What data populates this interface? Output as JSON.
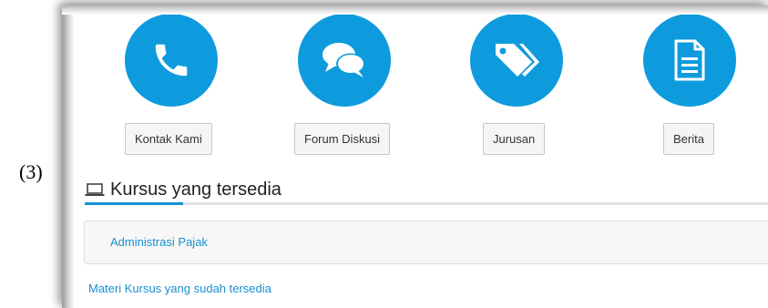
{
  "figure_label": "(3)",
  "quick_links": [
    {
      "label": "Kontak Kami",
      "icon": "phone-icon"
    },
    {
      "label": "Forum Diskusi",
      "icon": "chat-bubbles-icon"
    },
    {
      "label": "Jurusan",
      "icon": "tags-icon"
    },
    {
      "label": "Berita",
      "icon": "document-icon"
    }
  ],
  "section": {
    "title": "Kursus yang tersedia",
    "icon": "laptop-icon"
  },
  "courses": [
    {
      "name": "Administrasi Pajak"
    }
  ],
  "materials_link": "Materi Kursus yang sudah tersedia",
  "colors": {
    "accent": "#0e9bde",
    "link": "#1a8fcf",
    "button_bg": "#f5f5f5"
  }
}
